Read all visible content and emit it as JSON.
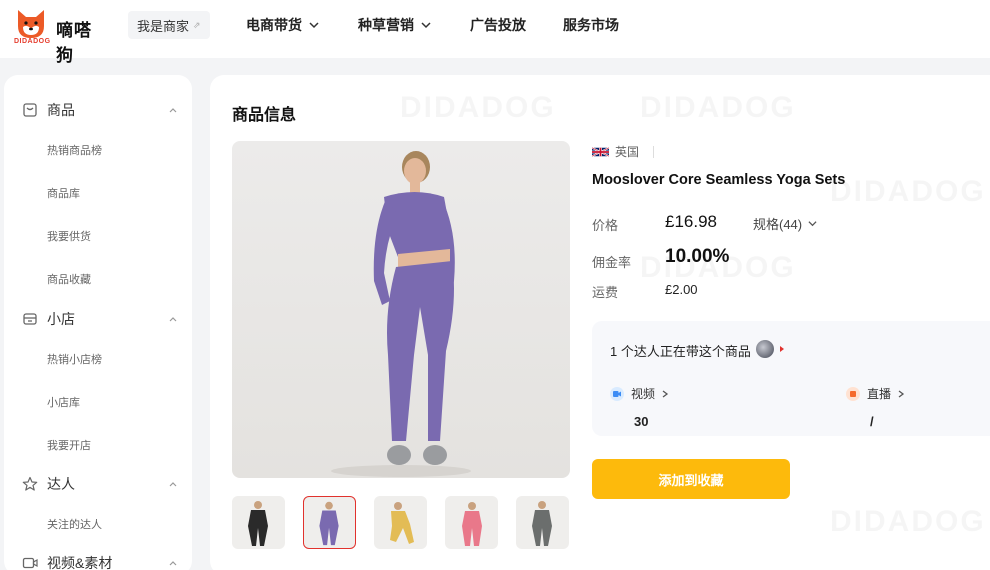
{
  "header": {
    "logo_text": "嘀嗒狗",
    "logo_sub": "DIDADOG",
    "merchant_label": "我是商家",
    "nav": [
      {
        "label": "电商带货",
        "has_dropdown": true
      },
      {
        "label": "种草营销",
        "has_dropdown": true
      },
      {
        "label": "广告投放",
        "has_dropdown": false
      },
      {
        "label": "服务市场",
        "has_dropdown": false
      }
    ]
  },
  "sidebar": {
    "groups": [
      {
        "label": "商品",
        "icon": "box-icon",
        "items": [
          "热销商品榜",
          "商品库",
          "我要供货",
          "商品收藏"
        ]
      },
      {
        "label": "小店",
        "icon": "store-icon",
        "items": [
          "热销小店榜",
          "小店库",
          "我要开店"
        ]
      },
      {
        "label": "达人",
        "icon": "star-icon",
        "items": [
          "关注的达人"
        ]
      },
      {
        "label": "视频&素材",
        "icon": "video-icon",
        "items": []
      }
    ]
  },
  "main": {
    "section_title": "商品信息",
    "watermark": "DIDADOG",
    "product": {
      "country": "英国",
      "title": "Mooslover Core Seamless Yoga Sets",
      "price_label": "价格",
      "price": "£16.98",
      "spec_label": "规格(44)",
      "commission_label": "佣金率",
      "commission": "10.00%",
      "shipping_label": "运费",
      "shipping": "£2.00"
    },
    "thumbnails": [
      {
        "name": "black",
        "color": "#2a2a2a"
      },
      {
        "name": "purple",
        "color": "#7a6ab0",
        "selected": true
      },
      {
        "name": "yellow",
        "color": "#e3bc55"
      },
      {
        "name": "pink",
        "color": "#e9788a"
      },
      {
        "name": "gray",
        "color": "#6b6e6d"
      }
    ],
    "kol": {
      "title": "1 个达人正在带这个商品",
      "video_label": "视频",
      "video_value": "30",
      "live_label": "直播",
      "live_value": "/"
    },
    "favorite_button": "添加到收藏"
  },
  "colors": {
    "accent": "#fdba0c",
    "selected_border": "#e1322d",
    "product_purple": "#7a6ab0"
  }
}
